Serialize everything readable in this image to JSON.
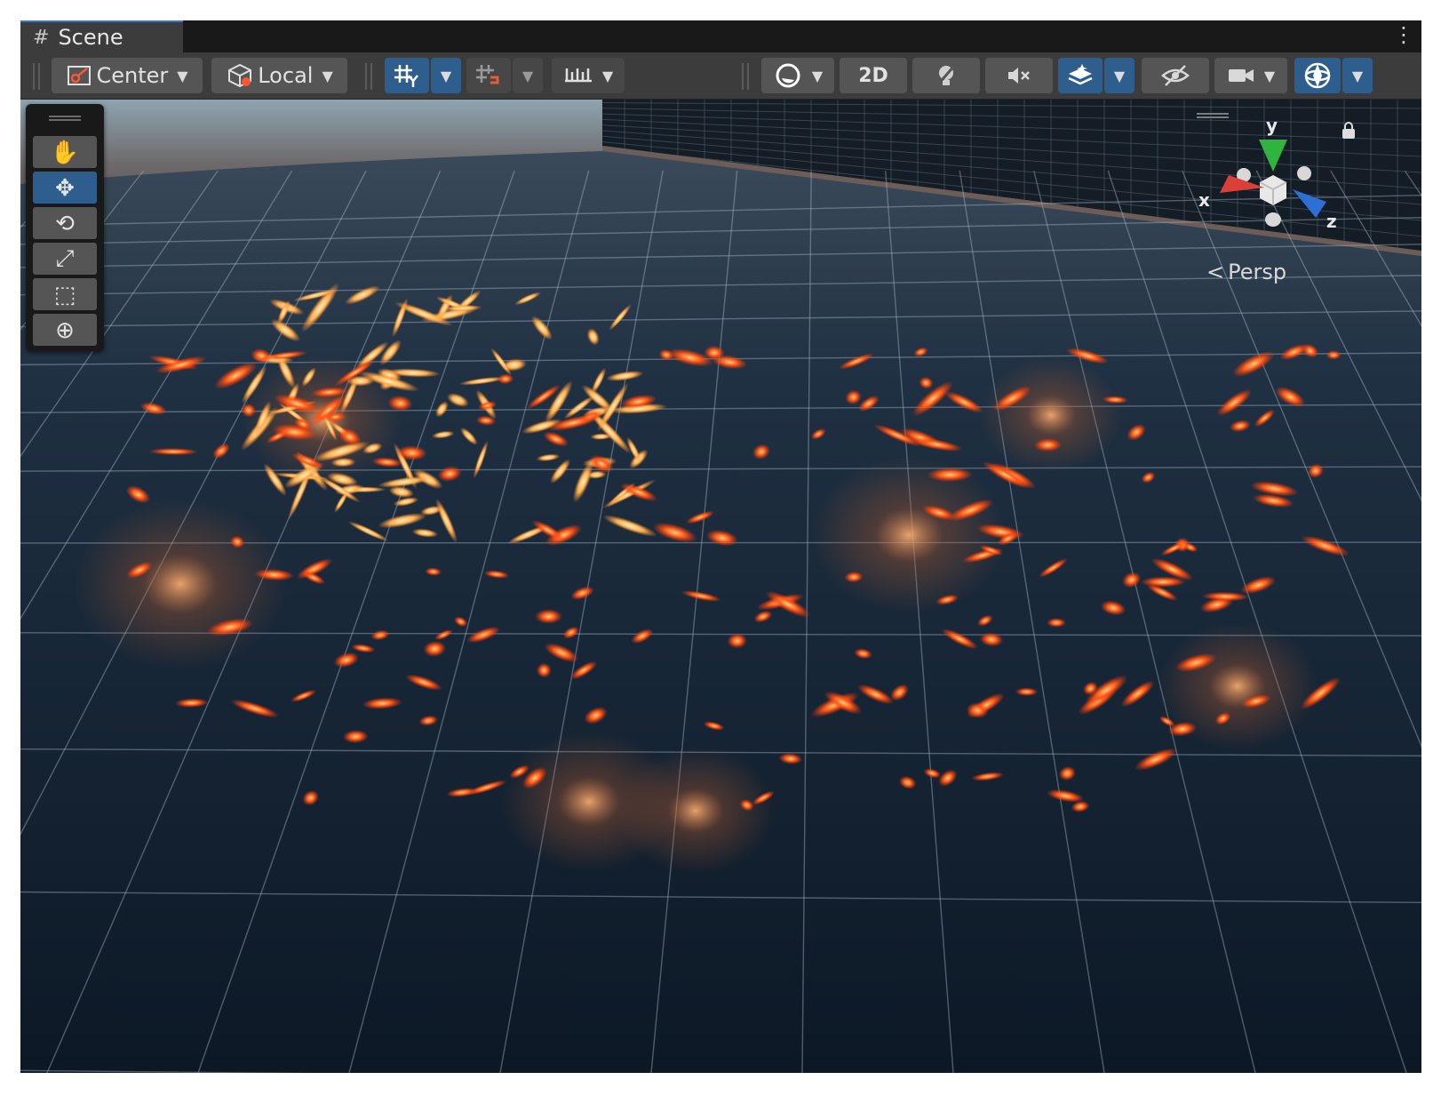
{
  "tab": {
    "icon": "hash-grid-icon",
    "icon_glyph": "#",
    "title": "Scene"
  },
  "toolbar": {
    "pivot_mode_label": "Center",
    "pivot_rotation_label": "Local",
    "view_2d_label": "2D"
  },
  "tools": [
    {
      "name": "hand-tool-button",
      "icon": "hand-icon",
      "glyph": "✋",
      "active": false
    },
    {
      "name": "move-tool-button",
      "icon": "move-arrows-icon",
      "glyph": "✥",
      "active": true
    },
    {
      "name": "rotate-tool-button",
      "icon": "rotate-icon",
      "glyph": "⟲",
      "active": false
    },
    {
      "name": "scale-tool-button",
      "icon": "scale-icon",
      "glyph": "⤢",
      "active": false
    },
    {
      "name": "rect-tool-button",
      "icon": "rect-transform-icon",
      "glyph": "⬚",
      "active": false
    },
    {
      "name": "transform-tool-button",
      "icon": "transform-icon",
      "glyph": "⊕",
      "active": false
    }
  ],
  "gizmo": {
    "x_label": "x",
    "y_label": "y",
    "z_label": "z",
    "x_color": "#d9403a",
    "y_color": "#2fb43e",
    "z_color": "#2e6fd6"
  },
  "projection": {
    "label": "Persp"
  },
  "colors": {
    "toolbar_bg": "#3c3c3c",
    "button_bg": "#555555",
    "active_bg": "#2d5e8e",
    "floor": "#152233",
    "spark_hot": "#ffb25a",
    "spark_ember": "#ff4a12"
  }
}
